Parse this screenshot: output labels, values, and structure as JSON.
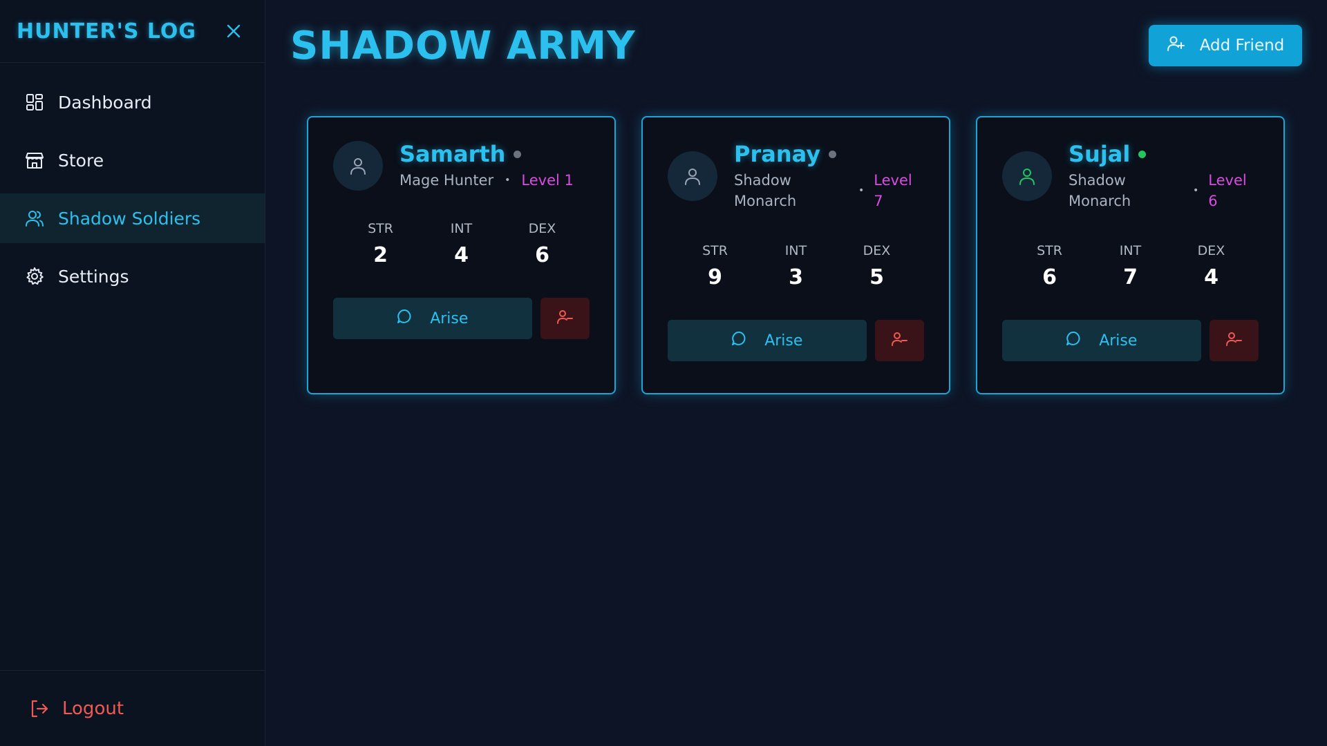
{
  "sidebar": {
    "brand": "HUNTER'S LOG",
    "items": [
      {
        "label": "Dashboard",
        "icon": "grid-icon"
      },
      {
        "label": "Store",
        "icon": "store-icon"
      },
      {
        "label": "Shadow Soldiers",
        "icon": "users-icon",
        "active": true
      },
      {
        "label": "Settings",
        "icon": "gear-icon"
      }
    ],
    "logout": "Logout"
  },
  "header": {
    "title": "SHADOW ARMY",
    "add_friend": "Add Friend"
  },
  "colors": {
    "accent": "#2cc0ef",
    "level": "#d94ce0",
    "online": "#22c55e",
    "offline": "#6b7280",
    "danger": "#f05a52"
  },
  "cards": [
    {
      "name": "Samarth",
      "online": false,
      "class": "Mage Hunter",
      "level": "Level 1",
      "stats": [
        {
          "label": "STR",
          "value": "2"
        },
        {
          "label": "INT",
          "value": "4"
        },
        {
          "label": "DEX",
          "value": "6"
        }
      ],
      "action": "Arise"
    },
    {
      "name": "Pranay",
      "online": false,
      "class": "Shadow Monarch",
      "level": "Level 7",
      "stats": [
        {
          "label": "STR",
          "value": "9"
        },
        {
          "label": "INT",
          "value": "3"
        },
        {
          "label": "DEX",
          "value": "5"
        }
      ],
      "action": "Arise"
    },
    {
      "name": "Sujal",
      "online": true,
      "class": "Shadow Monarch",
      "level": "Level 6",
      "stats": [
        {
          "label": "STR",
          "value": "6"
        },
        {
          "label": "INT",
          "value": "7"
        },
        {
          "label": "DEX",
          "value": "4"
        }
      ],
      "action": "Arise"
    }
  ]
}
